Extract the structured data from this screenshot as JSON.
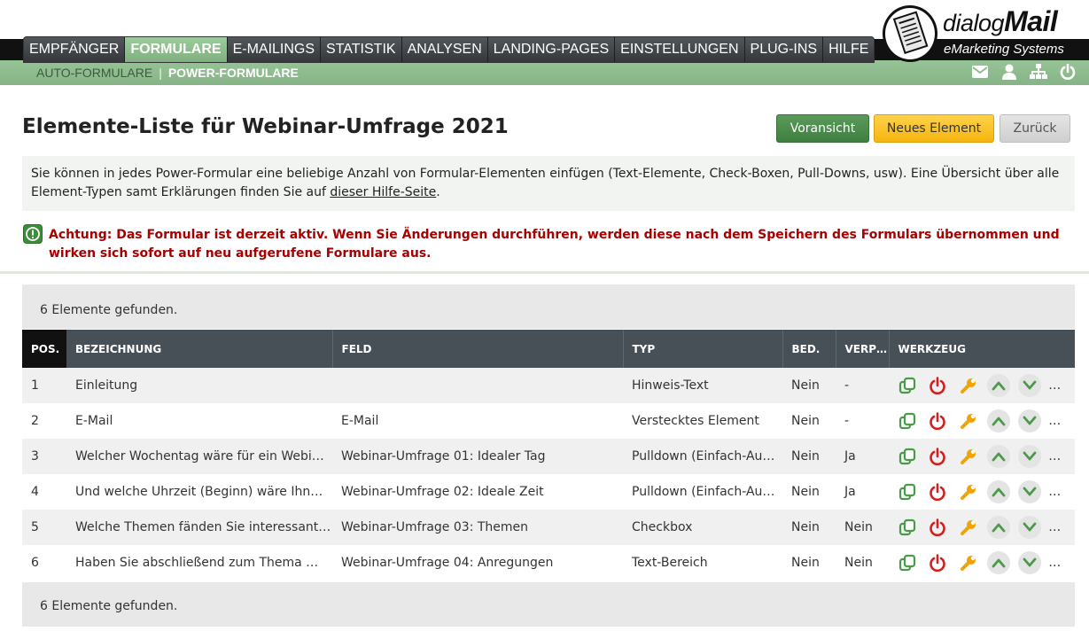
{
  "brand": {
    "name_light": "dialog",
    "name_bold": "Mail",
    "tagline": "eMarketing Systems"
  },
  "nav": {
    "items": [
      {
        "label": "EMPFÄNGER"
      },
      {
        "label": "FORMULARE"
      },
      {
        "label": "E-MAILINGS"
      },
      {
        "label": "STATISTIK"
      },
      {
        "label": "ANALYSEN"
      },
      {
        "label": "LANDING-PAGES"
      },
      {
        "label": "EINSTELLUNGEN"
      },
      {
        "label": "PLUG-INS"
      },
      {
        "label": "HILFE"
      }
    ],
    "active": "FORMULARE"
  },
  "subnav": {
    "items": [
      {
        "label": "AUTO-FORMULARE"
      },
      {
        "label": "POWER-FORMULARE"
      }
    ],
    "separator": "|",
    "active": "POWER-FORMULARE"
  },
  "topicons": [
    "envelope-icon",
    "user-icon",
    "sitemap-icon",
    "power-icon"
  ],
  "page": {
    "title": "Elemente-Liste für Webinar-Umfrage 2021",
    "buttons": {
      "preview": "Voransicht",
      "new_element": "Neues Element",
      "back": "Zurück"
    },
    "info_text": "Sie können in jedes Power-Formular eine beliebige Anzahl von Formular-Elementen einfügen (Text-Elemente, Check-Boxen, Pull-Downs, usw). Eine Übersicht über alle Element-Typen samt Erklärungen finden Sie auf ",
    "info_link": "dieser Hilfe-Seite",
    "info_end": ".",
    "warning": "Achtung: Das Formular ist derzeit aktiv. Wenn Sie Änderungen durchführen, werden diese nach dem Speichern des Formulars übernommen und wirken sich sofort auf neu aufgerufene Formulare aus."
  },
  "results": {
    "top": "6 Elemente gefunden.",
    "bottom": "6 Elemente gefunden."
  },
  "table": {
    "columns": {
      "pos": "POS.",
      "bezeichnung": "BEZEICHNUNG",
      "feld": "FELD",
      "typ": "TYP",
      "bed": "BED.",
      "verp": "VERP…",
      "werkzeug": "WERKZEUG"
    },
    "rows": [
      {
        "pos": "1",
        "bezeichnung": "Einleitung",
        "feld": "",
        "typ": "Hinweis-Text",
        "bed": "Nein",
        "verp": "-"
      },
      {
        "pos": "2",
        "bezeichnung": "E-Mail",
        "feld": "E-Mail",
        "typ": "Verstecktes Element",
        "bed": "Nein",
        "verp": "-"
      },
      {
        "pos": "3",
        "bezeichnung": "Welcher Wochentag wäre für ein Webi…",
        "feld": "Webinar-Umfrage 01: Idealer Tag",
        "typ": "Pulldown (Einfach-Au…",
        "bed": "Nein",
        "verp": "Ja"
      },
      {
        "pos": "4",
        "bezeichnung": "Und welche Uhrzeit (Beginn) wäre Ihn…",
        "feld": "Webinar-Umfrage 02: Ideale Zeit",
        "typ": "Pulldown (Einfach-Au…",
        "bed": "Nein",
        "verp": "Ja"
      },
      {
        "pos": "5",
        "bezeichnung": "Welche Themen fänden Sie interessant…",
        "feld": "Webinar-Umfrage 03: Themen",
        "typ": "Checkbox",
        "bed": "Nein",
        "verp": "Nein"
      },
      {
        "pos": "6",
        "bezeichnung": "Haben Sie abschließend zum Thema …",
        "feld": "Webinar-Umfrage 04: Anregungen",
        "typ": "Text-Bereich",
        "bed": "Nein",
        "verp": "Nein"
      }
    ],
    "tools": [
      "copy-icon",
      "power-icon",
      "wrench-icon",
      "arrow-up-icon",
      "arrow-down-icon",
      "trash-icon"
    ]
  },
  "colors": {
    "accent_green": "#8fbc8f",
    "nav_dark": "#3b3f42",
    "warning_red": "#a80000",
    "tool_green": "#4a9a4a",
    "tool_red": "#d42020",
    "tool_orange": "#f2a300"
  }
}
